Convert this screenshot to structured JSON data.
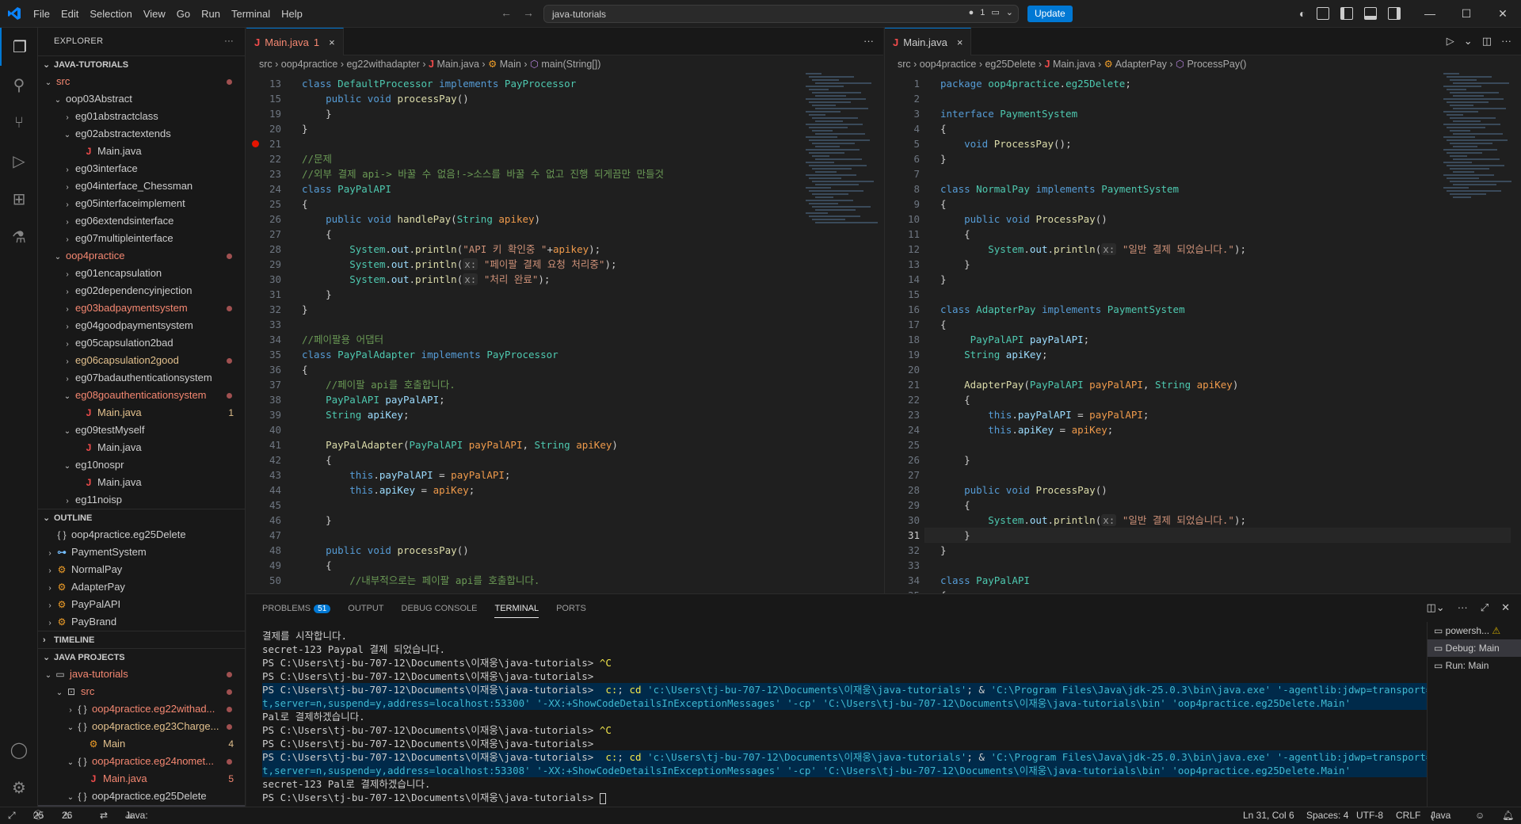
{
  "titlebar": {
    "menu": [
      "File",
      "Edit",
      "Selection",
      "View",
      "Go",
      "Run",
      "Terminal",
      "Help"
    ],
    "search": "java-tutorials",
    "notif_count": "1",
    "update_label": "Update"
  },
  "sidebar": {
    "explorer_title": "EXPLORER",
    "project_title": "JAVA-TUTORIALS",
    "tree": [
      {
        "label": "src",
        "indent": 0,
        "type": "folder",
        "open": true,
        "cls": "err",
        "dot": true
      },
      {
        "label": "oop03Abstract",
        "indent": 1,
        "type": "folder",
        "open": true
      },
      {
        "label": "eg01abstractclass",
        "indent": 2,
        "type": "folder",
        "open": false
      },
      {
        "label": "eg02abstractextends",
        "indent": 2,
        "type": "folder",
        "open": true
      },
      {
        "label": "Main.java",
        "indent": 3,
        "type": "java"
      },
      {
        "label": "eg03interface",
        "indent": 2,
        "type": "folder",
        "open": false
      },
      {
        "label": "eg04interface_Chessman",
        "indent": 2,
        "type": "folder",
        "open": false
      },
      {
        "label": "eg05interfaceimplement",
        "indent": 2,
        "type": "folder",
        "open": false
      },
      {
        "label": "eg06extendsinterface",
        "indent": 2,
        "type": "folder",
        "open": false
      },
      {
        "label": "eg07multipleinterface",
        "indent": 2,
        "type": "folder",
        "open": false
      },
      {
        "label": "oop4practice",
        "indent": 1,
        "type": "folder",
        "open": true,
        "cls": "err",
        "dot": true
      },
      {
        "label": "eg01encapsulation",
        "indent": 2,
        "type": "folder",
        "open": false
      },
      {
        "label": "eg02dependencyinjection",
        "indent": 2,
        "type": "folder",
        "open": false
      },
      {
        "label": "eg03badpaymentsystem",
        "indent": 2,
        "type": "folder",
        "open": false,
        "cls": "err",
        "dot": true
      },
      {
        "label": "eg04goodpaymentsystem",
        "indent": 2,
        "type": "folder",
        "open": false
      },
      {
        "label": "eg05capsulation2bad",
        "indent": 2,
        "type": "folder",
        "open": false
      },
      {
        "label": "eg06capsulation2good",
        "indent": 2,
        "type": "folder",
        "open": false,
        "cls": "mod",
        "dot": true
      },
      {
        "label": "eg07badauthenticationsystem",
        "indent": 2,
        "type": "folder",
        "open": false
      },
      {
        "label": "eg08goauthenticationsystem",
        "indent": 2,
        "type": "folder",
        "open": true,
        "cls": "err",
        "dot": true
      },
      {
        "label": "Main.java",
        "indent": 3,
        "type": "java",
        "cls": "mod",
        "count": "1"
      },
      {
        "label": "eg09testMyself",
        "indent": 2,
        "type": "folder",
        "open": true
      },
      {
        "label": "Main.java",
        "indent": 3,
        "type": "java"
      },
      {
        "label": "eg10nospr",
        "indent": 2,
        "type": "folder",
        "open": true
      },
      {
        "label": "Main.java",
        "indent": 3,
        "type": "java"
      },
      {
        "label": "eg11noisp",
        "indent": 2,
        "type": "folder",
        "open": false
      }
    ],
    "outline_title": "OUTLINE",
    "outline": [
      {
        "label": "oop4practice.eg25Delete",
        "icon": "{ }",
        "cls": "gr",
        "chev": false
      },
      {
        "label": "PaymentSystem",
        "icon": "⊶",
        "cls": "bl",
        "chev": true
      },
      {
        "label": "NormalPay",
        "icon": "⚙",
        "cls": "ob",
        "chev": true
      },
      {
        "label": "AdapterPay",
        "icon": "⚙",
        "cls": "ob",
        "chev": true
      },
      {
        "label": "PayPalAPI",
        "icon": "⚙",
        "cls": "ob",
        "chev": true
      },
      {
        "label": "PayBrand",
        "icon": "⚙",
        "cls": "ob",
        "chev": true
      }
    ],
    "timeline_title": "TIMELINE",
    "projects_title": "JAVA PROJECTS",
    "projects": [
      {
        "label": "java-tutorials",
        "indent": 0,
        "icon": "▭",
        "cls": "err",
        "dot": true,
        "chev": "open"
      },
      {
        "label": "src",
        "indent": 1,
        "icon": "⊡",
        "cls": "err",
        "dot": true,
        "chev": "open"
      },
      {
        "label": "oop4practice.eg22withad...",
        "indent": 2,
        "icon": "{ }",
        "cls": "err",
        "dot": true,
        "chev": "closed"
      },
      {
        "label": "oop4practice.eg23Charge...",
        "indent": 2,
        "icon": "{ }",
        "cls": "mod",
        "dot": true,
        "chev": "open"
      },
      {
        "label": "Main",
        "indent": 3,
        "icon": "⚙",
        "cls": "mod",
        "count": "4"
      },
      {
        "label": "oop4practice.eg24nomet...",
        "indent": 2,
        "icon": "{ }",
        "cls": "err",
        "dot": true,
        "chev": "open"
      },
      {
        "label": "Main.java",
        "indent": 3,
        "icon": "J",
        "cls": "err",
        "count": "5"
      },
      {
        "label": "oop4practice.eg25Delete",
        "indent": 2,
        "icon": "{ }",
        "chev": "open"
      },
      {
        "label": "Main",
        "indent": 3,
        "icon": "⚙",
        "sel": true
      }
    ]
  },
  "editor_left": {
    "tab": "Main.java",
    "tab_badge": "1",
    "crumbs": [
      "src",
      "oop4practice",
      "eg22withadapter",
      "Main.java",
      "Main",
      "main(String[])"
    ],
    "lines": [
      {
        "n": "13",
        "html": "<span class=\"kw\">class</span> <span class=\"ty\">DefaultProcessor</span> <span class=\"kw\">implements</span> <span class=\"ty\">PayProcessor</span>"
      },
      {
        "n": "15",
        "html": "    <span class=\"kw\">public</span> <span class=\"kw\">void</span> <span class=\"fn\">processPay</span>()"
      },
      {
        "n": "19",
        "html": "    }"
      },
      {
        "n": "20",
        "html": "}"
      },
      {
        "n": "21",
        "html": "",
        "bp": true
      },
      {
        "n": "22",
        "html": "<span class=\"cm\">//문제</span>"
      },
      {
        "n": "23",
        "html": "<span class=\"cm\">//외부 결제 api-&gt; 바꿀 수 없음!-&gt;소스를 바꿀 수 없고 진행 되게끔만 만들것</span>"
      },
      {
        "n": "24",
        "html": "<span class=\"kw\">class</span> <span class=\"ty\">PayPalAPI</span>"
      },
      {
        "n": "25",
        "html": "{"
      },
      {
        "n": "26",
        "html": "    <span class=\"kw\">public</span> <span class=\"kw\">void</span> <span class=\"fn\">handlePay</span>(<span class=\"ty\">String</span> <span class=\"pf\">apikey</span>)"
      },
      {
        "n": "27",
        "html": "    {"
      },
      {
        "n": "28",
        "html": "        <span class=\"ty\">System</span>.<span class=\"pm\">out</span>.<span class=\"fn\">println</span>(<span class=\"st\">\"API 키 확인중 \"</span>+<span class=\"pf\">apikey</span>);"
      },
      {
        "n": "29",
        "html": "        <span class=\"ty\">System</span>.<span class=\"pm\">out</span>.<span class=\"fn\">println</span>(<span class=\"hint\">x:</span> <span class=\"st\">\"페이팔 결제 요청 처리중\"</span>);"
      },
      {
        "n": "30",
        "html": "        <span class=\"ty\">System</span>.<span class=\"pm\">out</span>.<span class=\"fn\">println</span>(<span class=\"hint\">x:</span> <span class=\"st\">\"처리 완료\"</span>);"
      },
      {
        "n": "31",
        "html": "    }"
      },
      {
        "n": "32",
        "html": "}"
      },
      {
        "n": "33",
        "html": ""
      },
      {
        "n": "34",
        "html": "<span class=\"cm\">//페이팔용 어댑터</span>"
      },
      {
        "n": "35",
        "html": "<span class=\"kw\">class</span> <span class=\"ty\">PayPalAdapter</span> <span class=\"kw\">implements</span> <span class=\"ty\">PayProcessor</span>"
      },
      {
        "n": "36",
        "html": "{"
      },
      {
        "n": "37",
        "html": "    <span class=\"cm\">//페이팔 api를 호출합니다.</span>"
      },
      {
        "n": "38",
        "html": "    <span class=\"ty\">PayPalAPI</span> <span class=\"pm\">payPalAPI</span>;"
      },
      {
        "n": "39",
        "html": "    <span class=\"ty\">String</span> <span class=\"pm\">apiKey</span>;"
      },
      {
        "n": "40",
        "html": ""
      },
      {
        "n": "41",
        "html": "    <span class=\"fn\">PayPalAdapter</span>(<span class=\"ty\">PayPalAPI</span> <span class=\"pf\">payPalAPI</span>, <span class=\"ty\">String</span> <span class=\"pf\">apiKey</span>)"
      },
      {
        "n": "42",
        "html": "    {"
      },
      {
        "n": "43",
        "html": "        <span class=\"kw\">this</span>.<span class=\"pm\">payPalAPI</span> = <span class=\"pf\">payPalAPI</span>;"
      },
      {
        "n": "44",
        "html": "        <span class=\"kw\">this</span>.<span class=\"pm\">apiKey</span> = <span class=\"pf\">apiKey</span>;"
      },
      {
        "n": "45",
        "html": ""
      },
      {
        "n": "46",
        "html": "    }"
      },
      {
        "n": "47",
        "html": ""
      },
      {
        "n": "48",
        "html": "    <span class=\"kw\">public</span> <span class=\"kw\">void</span> <span class=\"fn\">processPay</span>()"
      },
      {
        "n": "49",
        "html": "    {"
      },
      {
        "n": "50",
        "html": "        <span class=\"cm\">//내부적으로는 페이팔 api를 호출합니다.</span>"
      }
    ]
  },
  "editor_right": {
    "tab": "Main.java",
    "crumbs": [
      "src",
      "oop4practice",
      "eg25Delete",
      "Main.java",
      "AdapterPay",
      "ProcessPay()"
    ],
    "lines": [
      {
        "n": "1",
        "html": "<span class=\"kw\">package</span> <span class=\"ty\">oop4practice</span>.<span class=\"ty\">eg25Delete</span>;"
      },
      {
        "n": "2",
        "html": ""
      },
      {
        "n": "3",
        "html": "<span class=\"kw\">interface</span> <span class=\"ty\">PaymentSystem</span>"
      },
      {
        "n": "4",
        "html": "{"
      },
      {
        "n": "5",
        "html": "    <span class=\"kw\">void</span> <span class=\"fn\">ProcessPay</span>();"
      },
      {
        "n": "6",
        "html": "}"
      },
      {
        "n": "7",
        "html": ""
      },
      {
        "n": "8",
        "html": "<span class=\"kw\">class</span> <span class=\"ty\">NormalPay</span> <span class=\"kw\">implements</span> <span class=\"ty\">PaymentSystem</span>"
      },
      {
        "n": "9",
        "html": "{"
      },
      {
        "n": "10",
        "html": "    <span class=\"kw\">public</span> <span class=\"kw\">void</span> <span class=\"fn\">ProcessPay</span>()"
      },
      {
        "n": "11",
        "html": "    {"
      },
      {
        "n": "12",
        "html": "        <span class=\"ty\">System</span>.<span class=\"pm\">out</span>.<span class=\"fn\">println</span>(<span class=\"hint\">x:</span> <span class=\"st\">\"일반 결제 되었습니다.\"</span>);"
      },
      {
        "n": "13",
        "html": "    }"
      },
      {
        "n": "14",
        "html": "}"
      },
      {
        "n": "15",
        "html": ""
      },
      {
        "n": "16",
        "html": "<span class=\"kw\">class</span> <span class=\"ty\">AdapterPay</span> <span class=\"kw\">implements</span> <span class=\"ty\">PaymentSystem</span>"
      },
      {
        "n": "17",
        "html": "{"
      },
      {
        "n": "18",
        "html": "     <span class=\"ty\">PayPalAPI</span> <span class=\"pm\">payPalAPI</span>;"
      },
      {
        "n": "19",
        "html": "    <span class=\"ty\">String</span> <span class=\"pm\">apiKey</span>;"
      },
      {
        "n": "20",
        "html": ""
      },
      {
        "n": "21",
        "html": "    <span class=\"fn\">AdapterPay</span>(<span class=\"ty\">PayPalAPI</span> <span class=\"pf\">payPalAPI</span>, <span class=\"ty\">String</span> <span class=\"pf\">apiKey</span>)"
      },
      {
        "n": "22",
        "html": "    {"
      },
      {
        "n": "23",
        "html": "        <span class=\"kw\">this</span>.<span class=\"pm\">payPalAPI</span> = <span class=\"pf\">payPalAPI</span>;"
      },
      {
        "n": "24",
        "html": "        <span class=\"kw\">this</span>.<span class=\"pm\">apiKey</span> = <span class=\"pf\">apiKey</span>;"
      },
      {
        "n": "25",
        "html": ""
      },
      {
        "n": "26",
        "html": "    }"
      },
      {
        "n": "27",
        "html": ""
      },
      {
        "n": "28",
        "html": "    <span class=\"kw\">public</span> <span class=\"kw\">void</span> <span class=\"fn\">ProcessPay</span>()"
      },
      {
        "n": "29",
        "html": "    {"
      },
      {
        "n": "30",
        "html": "        <span class=\"ty\">System</span>.<span class=\"pm\">out</span>.<span class=\"fn\">println</span>(<span class=\"hint\">x:</span> <span class=\"st\">\"일반 결제 되었습니다.\"</span>);"
      },
      {
        "n": "31",
        "html": "    }",
        "cur": true
      },
      {
        "n": "32",
        "html": "}"
      },
      {
        "n": "33",
        "html": ""
      },
      {
        "n": "34",
        "html": "<span class=\"kw\">class</span> <span class=\"ty\">PayPalAPI</span>"
      },
      {
        "n": "35",
        "html": "{"
      }
    ]
  },
  "panel": {
    "tabs": [
      "PROBLEMS",
      "OUTPUT",
      "DEBUG CONSOLE",
      "TERMINAL",
      "PORTS"
    ],
    "problems_count": "51",
    "terminal_lines": [
      {
        "html": "결제를 시작합니다."
      },
      {
        "html": "secret-123 Paypal 결제 되었습니다."
      },
      {
        "html": "PS C:\\Users\\tj-bu-707-12\\Documents\\이재웅\\java-tutorials> <span class=\"y\">^C</span>"
      },
      {
        "html": "PS C:\\Users\\tj-bu-707-12\\Documents\\이재웅\\java-tutorials>"
      },
      {
        "html": "PS C:\\Users\\tj-bu-707-12\\Documents\\이재웅\\java-tutorials>  <span class=\"y\">c:</span>; <span class=\"y\">cd</span> <span class=\"cy\">'c:\\Users\\tj-bu-707-12\\Documents\\이재웅\\java-tutorials'</span>; & <span class=\"cy\">'C:\\Program Files\\Java\\jdk-25.0.3\\bin\\java.exe'</span> <span class=\"cy\">'-agentlib:jdwp=transport=dt_socke</span>",
        "hl": true
      },
      {
        "html": "<span class=\"cy\">t,server=n,suspend=y,address=localhost:53300'</span> <span class=\"cy\">'-XX:+ShowCodeDetailsInExceptionMessages'</span> <span class=\"cy\">'-cp'</span> <span class=\"cy\">'C:\\Users\\tj-bu-707-12\\Documents\\이재웅\\java-tutorials\\bin'</span> <span class=\"cy\">'oop4practice.eg25Delete.Main'</span>",
        "hl": true
      },
      {
        "html": "Pal로 결제하겠습니다."
      },
      {
        "html": "PS C:\\Users\\tj-bu-707-12\\Documents\\이재웅\\java-tutorials> <span class=\"y\">^C</span>"
      },
      {
        "html": "PS C:\\Users\\tj-bu-707-12\\Documents\\이재웅\\java-tutorials>"
      },
      {
        "html": "PS C:\\Users\\tj-bu-707-12\\Documents\\이재웅\\java-tutorials>  <span class=\"y\">c:</span>; <span class=\"y\">cd</span> <span class=\"cy\">'c:\\Users\\tj-bu-707-12\\Documents\\이재웅\\java-tutorials'</span>; & <span class=\"cy\">'C:\\Program Files\\Java\\jdk-25.0.3\\bin\\java.exe'</span> <span class=\"cy\">'-agentlib:jdwp=transport=dt_socke</span>",
        "hl": true
      },
      {
        "html": "<span class=\"cy\">t,server=n,suspend=y,address=localhost:53308'</span> <span class=\"cy\">'-XX:+ShowCodeDetailsInExceptionMessages'</span> <span class=\"cy\">'-cp'</span> <span class=\"cy\">'C:\\Users\\tj-bu-707-12\\Documents\\이재웅\\java-tutorials\\bin'</span> <span class=\"cy\">'oop4practice.eg25Delete.Main'</span>",
        "hl": true
      },
      {
        "html": "secret-123 Pal로 결제하겠습니다."
      },
      {
        "html": "PS C:\\Users\\tj-bu-707-12\\Documents\\이재웅\\java-tutorials> <span class=\"cur\"></span>"
      }
    ],
    "terminal_list": [
      {
        "label": "powersh...",
        "warn": "⚠"
      },
      {
        "label": "Debug: Main",
        "sel": true
      },
      {
        "label": "Run: Main"
      }
    ]
  },
  "status": {
    "errors": "25",
    "warnings": "26",
    "java": "Java: Ready",
    "position": "Ln 31, Col 6",
    "spaces": "Spaces: 4",
    "encoding": "UTF-8",
    "eol": "CRLF",
    "lang": "Java"
  },
  "colors": {
    "accent": "#0078d4",
    "error": "#f48771",
    "modified": "#e2c08d"
  }
}
